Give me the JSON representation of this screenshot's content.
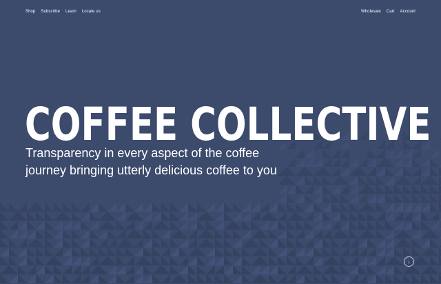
{
  "nav": {
    "left": [
      "Shop",
      "Subscribe",
      "Learn",
      "Locate us"
    ],
    "right": [
      "Wholesale",
      "Cart",
      "Account"
    ]
  },
  "hero": {
    "logo_text": "COFFEE COLLECTIVE",
    "tagline": "Transparency in every aspect of the coffee journey bringing utterly delicious coffee to you"
  },
  "scroll_icon": "arrow-down-circle-icon",
  "colors": {
    "background": "#3c4a6c",
    "text": "#ffffff",
    "pattern_dark": "#34415f",
    "pattern_light": "#44537a"
  }
}
